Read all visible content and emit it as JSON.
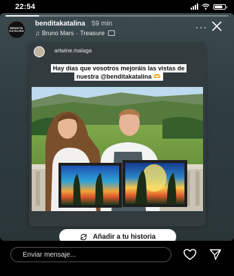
{
  "status_bar": {
    "time": "22:54",
    "battery_level": 0.75
  },
  "story": {
    "progress": 0.15,
    "avatar_text": "BENDITA KATALINA",
    "username": "benditakatalina",
    "time_ago": "59 min",
    "music": {
      "artist": "Bruno Mars",
      "separator": "·",
      "song": "Treasure"
    },
    "more_label": "···",
    "shared_post": {
      "username": "artwine.malaga",
      "caption": "Hay días que vosotros mejoráis las vistas de nuestra @benditakatalina 🫶"
    },
    "add_to_story_label": "Añadir a tu historia"
  },
  "reply": {
    "placeholder": "Enviar mensaje..."
  },
  "colors": {
    "background": "#000000",
    "story_bg": "#3b4a4e",
    "card_bg": "#333b3f"
  },
  "icons": [
    "signal-icon",
    "wifi-icon",
    "battery-icon",
    "close-icon",
    "music-note-icon",
    "repost-icon",
    "heart-icon",
    "send-icon"
  ]
}
